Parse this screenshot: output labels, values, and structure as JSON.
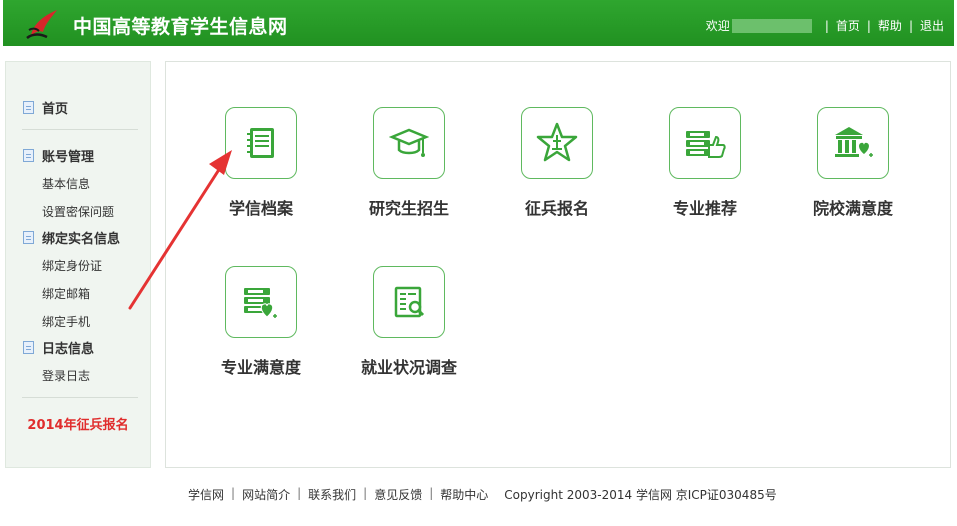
{
  "header": {
    "title": "中国高等教育学生信息网",
    "welcome": "欢迎",
    "nav": [
      "首页",
      "帮助",
      "退出"
    ]
  },
  "sidebar": {
    "home": "首页",
    "account": "账号管理",
    "account_items": [
      "基本信息",
      "设置密保问题"
    ],
    "bind": "绑定实名信息",
    "bind_items": [
      "绑定身份证",
      "绑定邮箱",
      "绑定手机"
    ],
    "log": "日志信息",
    "log_items": [
      "登录日志"
    ],
    "highlight": "2014年征兵报名"
  },
  "main": {
    "tiles": [
      "学信档案",
      "研究生招生",
      "征兵报名",
      "专业推荐",
      "院校满意度",
      "专业满意度",
      "就业状况调查"
    ]
  },
  "footer": {
    "links": [
      "学信网",
      "网站简介",
      "联系我们",
      "意见反馈",
      "帮助中心"
    ],
    "copyright": "Copyright 2003-2014 学信网 京ICP证030485号"
  },
  "colors": {
    "header_green": "#219121",
    "tile_border": "#5fb95f",
    "icon_green": "#3aa63a",
    "highlight_red": "#e02d2d",
    "arrow_red": "#e53333"
  }
}
